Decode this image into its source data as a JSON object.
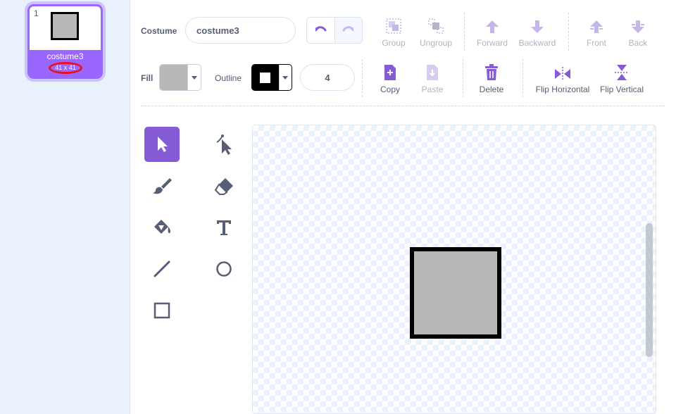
{
  "costume_list": {
    "items": [
      {
        "index": "1",
        "name": "costume3",
        "size": "41 x 41",
        "selected": true
      }
    ]
  },
  "toolbar": {
    "costume_label": "Costume",
    "costume_name": "costume3",
    "undo_icon": "undo-icon",
    "redo_icon": "redo-icon",
    "group": "Group",
    "ungroup": "Ungroup",
    "forward": "Forward",
    "backward": "Backward",
    "front": "Front",
    "back": "Back",
    "fill_label": "Fill",
    "outline_label": "Outline",
    "outline_width": "4",
    "copy": "Copy",
    "paste": "Paste",
    "delete": "Delete",
    "flip_horizontal": "Flip Horizontal",
    "flip_vertical": "Flip Vertical"
  },
  "tools": [
    "select",
    "reshape",
    "brush",
    "eraser",
    "fill",
    "text",
    "line",
    "circle",
    "rectangle"
  ],
  "colors": {
    "accent": "#855cd6",
    "selection": "#9966ff",
    "fill": "#b8b8b8",
    "outline": "#000000",
    "text": "#575e75",
    "size_highlight": "#e8131c"
  }
}
